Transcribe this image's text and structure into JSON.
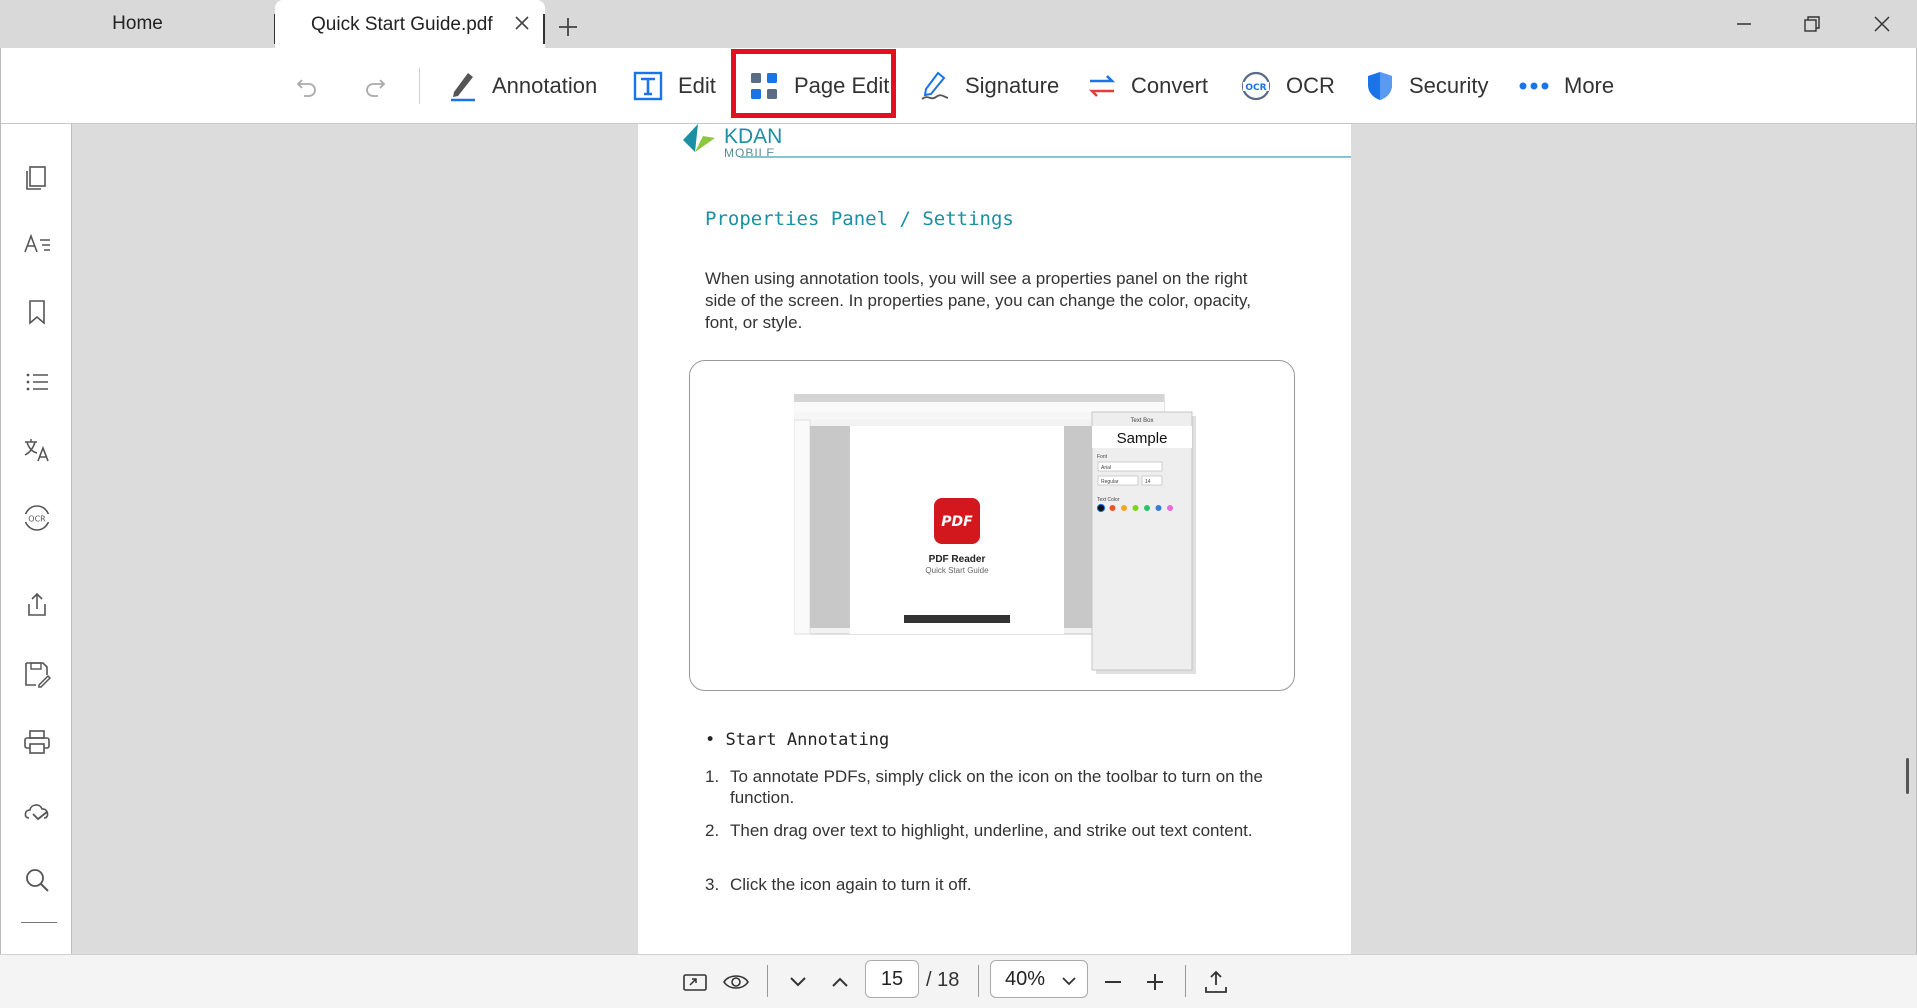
{
  "tabs": {
    "home_label": "Home",
    "doc_label": "Quick Start Guide.pdf"
  },
  "toolbar": {
    "annotation": "Annotation",
    "edit": "Edit",
    "page_edit": "Page Edit",
    "signature": "Signature",
    "convert": "Convert",
    "ocr": "OCR",
    "security": "Security",
    "more": "More"
  },
  "document": {
    "logo_name": "KDAN",
    "logo_sub": "MOBILE",
    "heading": "Properties Panel / Settings",
    "paragraph": "When using annotation tools, you will see a properties panel on the right side of the screen. In properties pane, you can change the color, opacity, font, or style.",
    "bullet": "Start Annotating",
    "steps": [
      {
        "num": "1.",
        "text": "To annotate PDFs, simply click on the icon on the toolbar to turn on the function."
      },
      {
        "num": "2.",
        "text": "Then drag over text to highlight, underline, and strike out text content."
      },
      {
        "num": "3.",
        "text": "Click the icon again to turn it off."
      }
    ],
    "figure": {
      "panel_title": "Text Box",
      "sample": "Sample",
      "font_label": "Font",
      "font_value": "Arial",
      "style_value": "Regular",
      "size_value": "14",
      "color_label": "Text Color",
      "app_name": "PDF Reader",
      "app_sub": "Quick Start Guide",
      "badge": "PDF",
      "swatches": [
        "#111111",
        "#e8532b",
        "#f5a623",
        "#7ed321",
        "#27c46b",
        "#3a7bd5",
        "#e86bd8"
      ]
    }
  },
  "bottombar": {
    "current_page": "15",
    "total_pages": "/ 18",
    "zoom": "40%"
  },
  "colors": {
    "accent": "#1a73e8",
    "highlight": "#e2121d",
    "heading": "#1b8fa3"
  }
}
